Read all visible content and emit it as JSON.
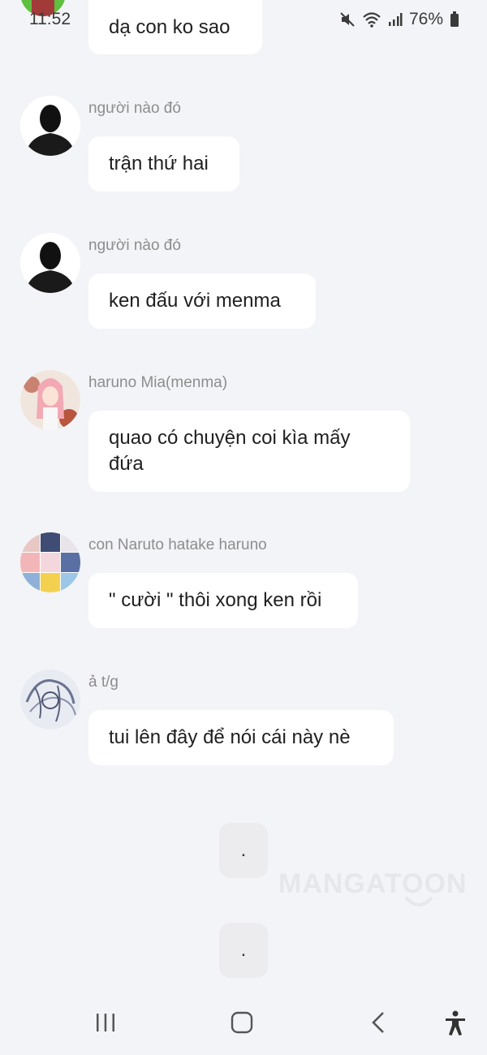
{
  "status_bar": {
    "time": "11:52",
    "battery": "76%"
  },
  "top_message": {
    "text": "dạ con ko sao"
  },
  "messages": [
    {
      "name": "người nào đó",
      "text": "trận thứ hai",
      "avatar": "silhouette-avatar"
    },
    {
      "name": "người nào đó",
      "text": "ken đấu với menma",
      "avatar": "silhouette-avatar"
    },
    {
      "name": "haruno Mia(menma)",
      "text_line1": "quao có chuyện coi kìa mấy",
      "text_line2": "đứa",
      "avatar": "anime-girl-avatar"
    },
    {
      "name": "con Naruto hatake haruno",
      "text": "\" cười \" thôi xong ken rồi",
      "avatar": "collage-avatar"
    },
    {
      "name": "ả t/g",
      "text": "tui lên đây để nói cái này nè",
      "avatar": "sketch-avatar"
    }
  ],
  "dot_bubbles": [
    {
      "text": "."
    },
    {
      "text": "."
    }
  ],
  "watermark": "MANGATOON",
  "colors": {
    "background": "#f3f4f7",
    "bubble": "#ffffff",
    "name_text": "#8d8d8d"
  }
}
